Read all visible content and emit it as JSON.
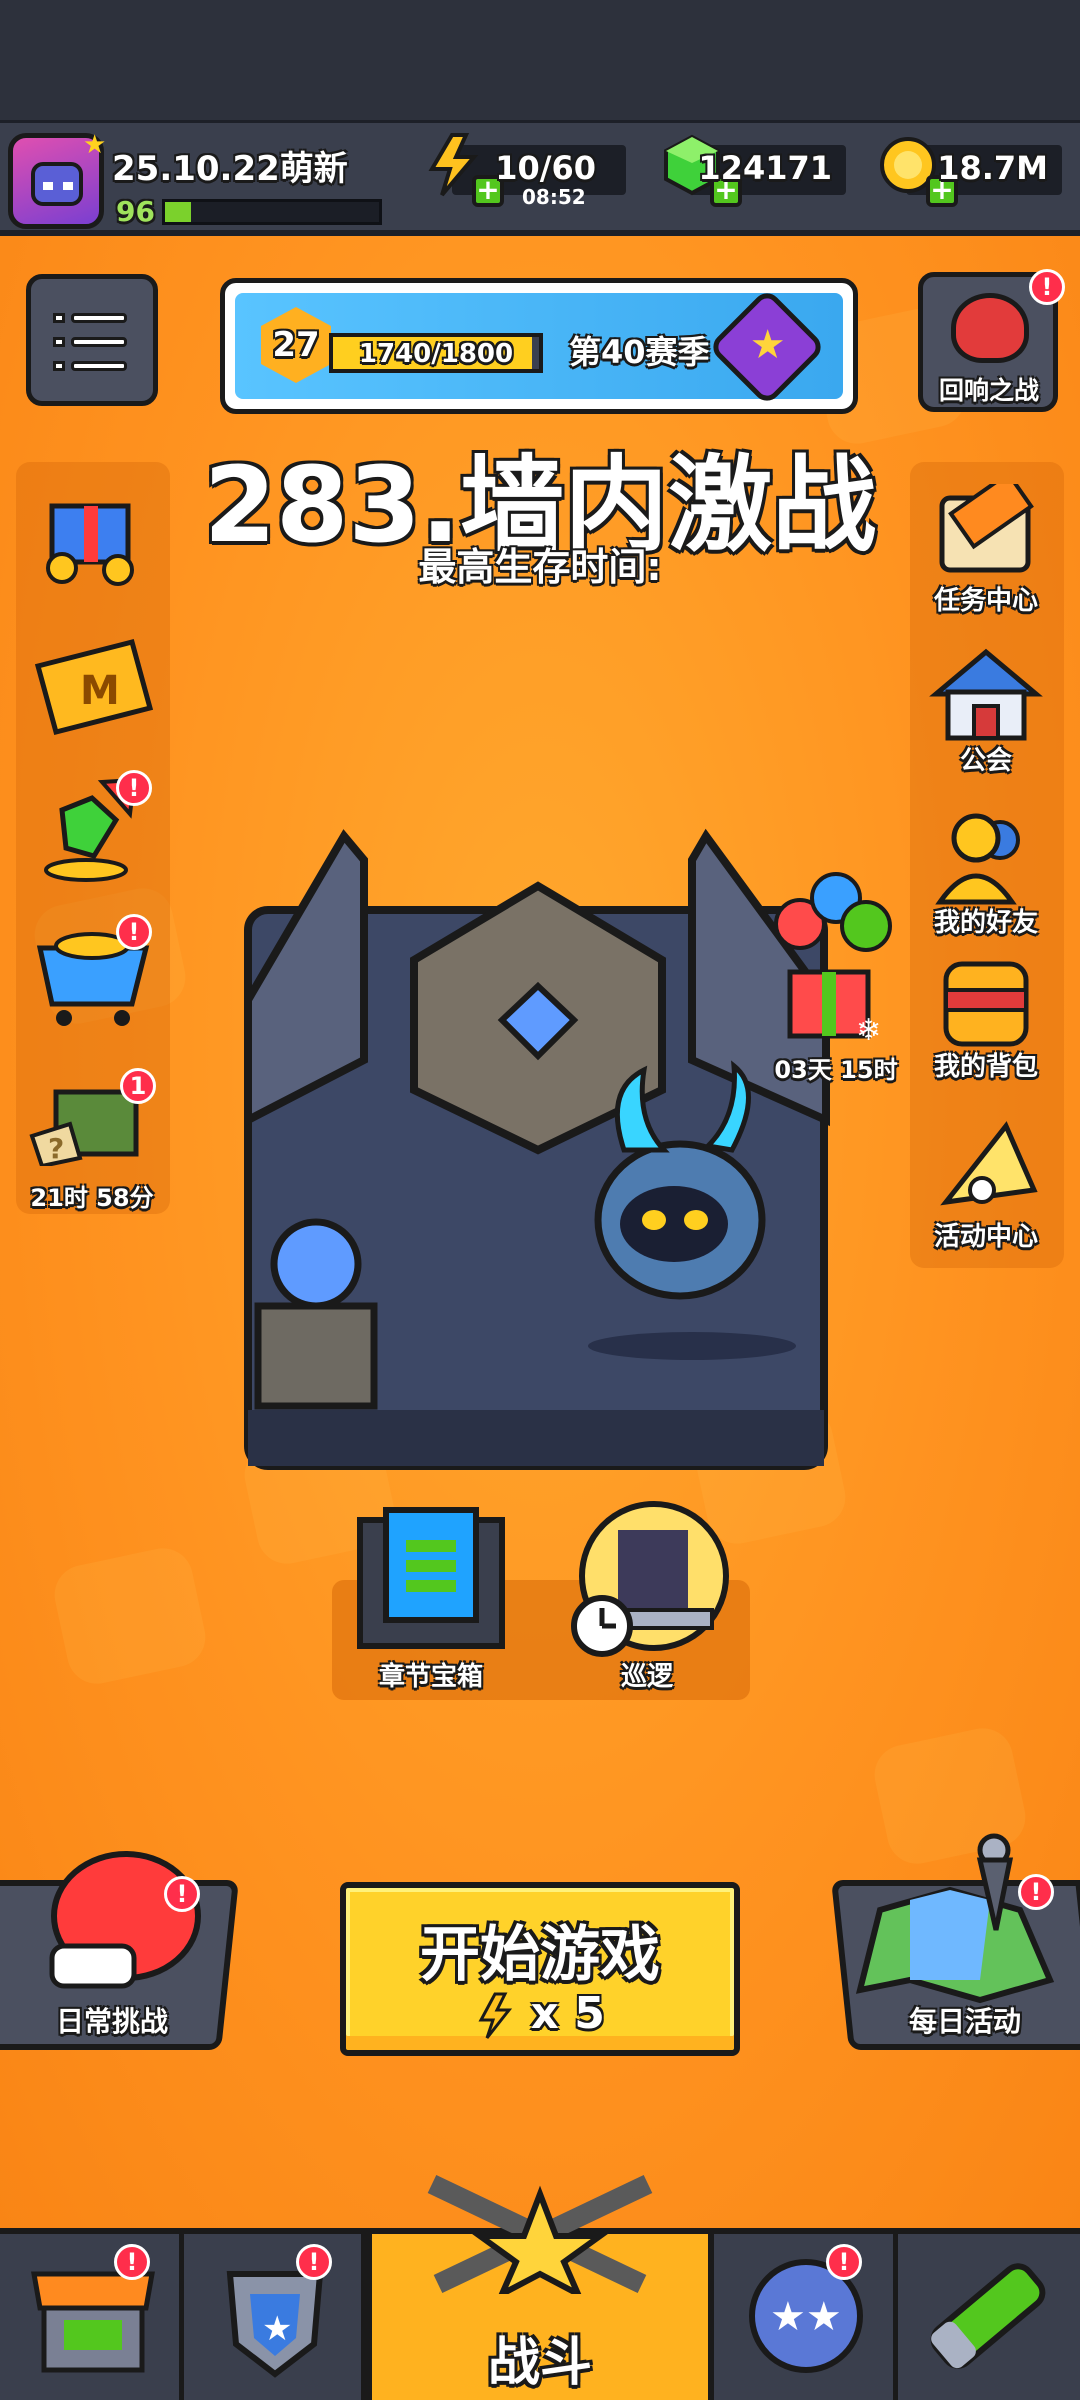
{
  "player": {
    "name": "25.10.22萌新",
    "level": "96",
    "xp_fraction": 0.12
  },
  "resources": {
    "energy": "10/60",
    "energy_timer": "08:52",
    "gems": "124171",
    "coins": "18.7M"
  },
  "season": {
    "level": "27",
    "progress": "1740/1800",
    "progress_fraction": 0.9667,
    "label": "第40赛季"
  },
  "echo_battle": {
    "label": "回响之战",
    "badge": "!"
  },
  "stage": {
    "title": "283.墙内激战",
    "survive_label": "最高生存时间:"
  },
  "left_items": [
    {
      "name": "gift",
      "badge": "",
      "label": ""
    },
    {
      "name": "monthly-card",
      "badge": "",
      "label": ""
    },
    {
      "name": "gem-upgrade",
      "badge": "!",
      "label": ""
    },
    {
      "name": "shop-cart",
      "badge": "!",
      "label": ""
    },
    {
      "name": "mystery-crate",
      "badge": "1",
      "label": "21时 58分"
    }
  ],
  "right_items": [
    {
      "name": "tasks",
      "label": "任务中心"
    },
    {
      "name": "guild",
      "label": "公会"
    },
    {
      "name": "friends",
      "label": "我的好友"
    },
    {
      "name": "backpack",
      "label": "我的背包"
    },
    {
      "name": "events",
      "label": "活动中心"
    }
  ],
  "balloon_gift": {
    "timer": "03天 15时"
  },
  "chapter_chest": {
    "label": "章节宝箱"
  },
  "patrol": {
    "label": "巡逻"
  },
  "daily_challenge": {
    "label": "日常挑战",
    "badge": "!"
  },
  "start_game": {
    "label": "开始游戏",
    "cost": "x 5"
  },
  "daily_activity": {
    "label": "每日活动",
    "badge": "!"
  },
  "nav": {
    "shop_badge": "!",
    "rank_badge": "!",
    "battle_label": "战斗",
    "skills_badge": "!"
  },
  "colors": {
    "main_orange": "#ff9320",
    "panel_dark": "#4b5060",
    "start_yellow": "#ffd22a",
    "badge_red": "#ff2e4b"
  }
}
